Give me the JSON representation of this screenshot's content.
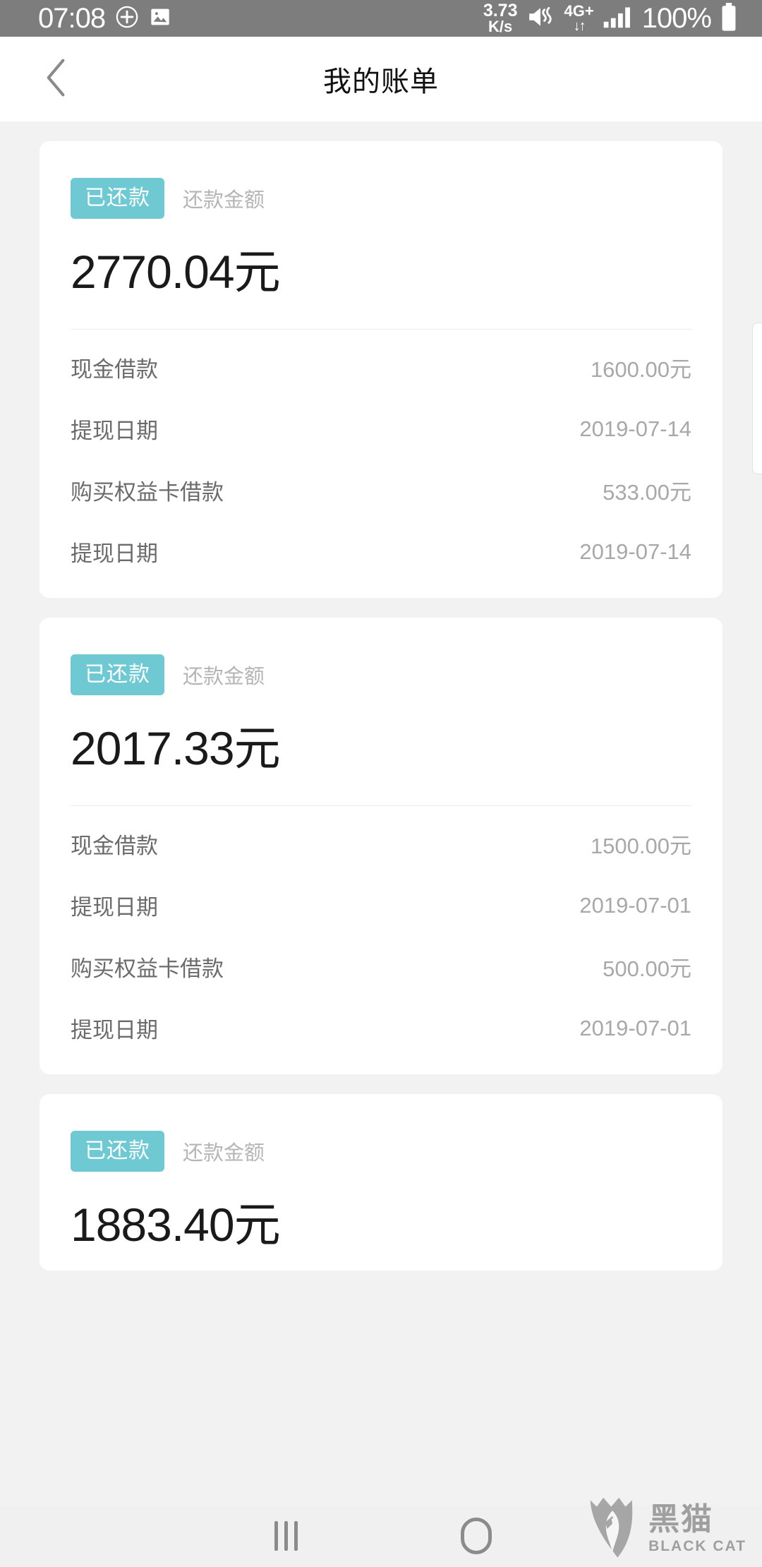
{
  "status_bar": {
    "clock": "07:08",
    "icons_left": [
      "navigation-plus-icon",
      "gallery-image-icon"
    ],
    "net_speed_value": "3.73",
    "net_speed_unit": "K/s",
    "mute_icon": "volume-mute-icon",
    "network_type": "4G+",
    "data_arrows": "↓↑",
    "signal_icon": "signal-bars-icon",
    "battery_percent": "100%",
    "battery_icon": "battery-full-icon",
    "background_color": "#7d7d7d"
  },
  "app_bar": {
    "back_icon": "chevron-left-icon",
    "title": "我的账单"
  },
  "theme": {
    "badge_color": "#6ec9d3",
    "page_background": "#f2f2f2",
    "card_background": "#ffffff",
    "label_color": "#6b6b6b",
    "value_color": "#a8a8a8",
    "amount_color": "#1a1a1a"
  },
  "bills": [
    {
      "status_badge": "已还款",
      "amount_label": "还款金额",
      "amount": "2770.04元",
      "rows": [
        {
          "label": "现金借款",
          "value": "1600.00元"
        },
        {
          "label": "提现日期",
          "value": "2019-07-14"
        },
        {
          "label": "购买权益卡借款",
          "value": "533.00元"
        },
        {
          "label": "提现日期",
          "value": "2019-07-14"
        }
      ]
    },
    {
      "status_badge": "已还款",
      "amount_label": "还款金额",
      "amount": "2017.33元",
      "rows": [
        {
          "label": "现金借款",
          "value": "1500.00元"
        },
        {
          "label": "提现日期",
          "value": "2019-07-01"
        },
        {
          "label": "购买权益卡借款",
          "value": "500.00元"
        },
        {
          "label": "提现日期",
          "value": "2019-07-01"
        }
      ]
    },
    {
      "status_badge": "已还款",
      "amount_label": "还款金额",
      "amount": "1883.40元",
      "rows": []
    }
  ],
  "nav_bar": {
    "recents_label": "recents-button",
    "home_label": "home-button"
  },
  "watermark": {
    "cn": "黑猫",
    "en": "BLACK CAT"
  }
}
